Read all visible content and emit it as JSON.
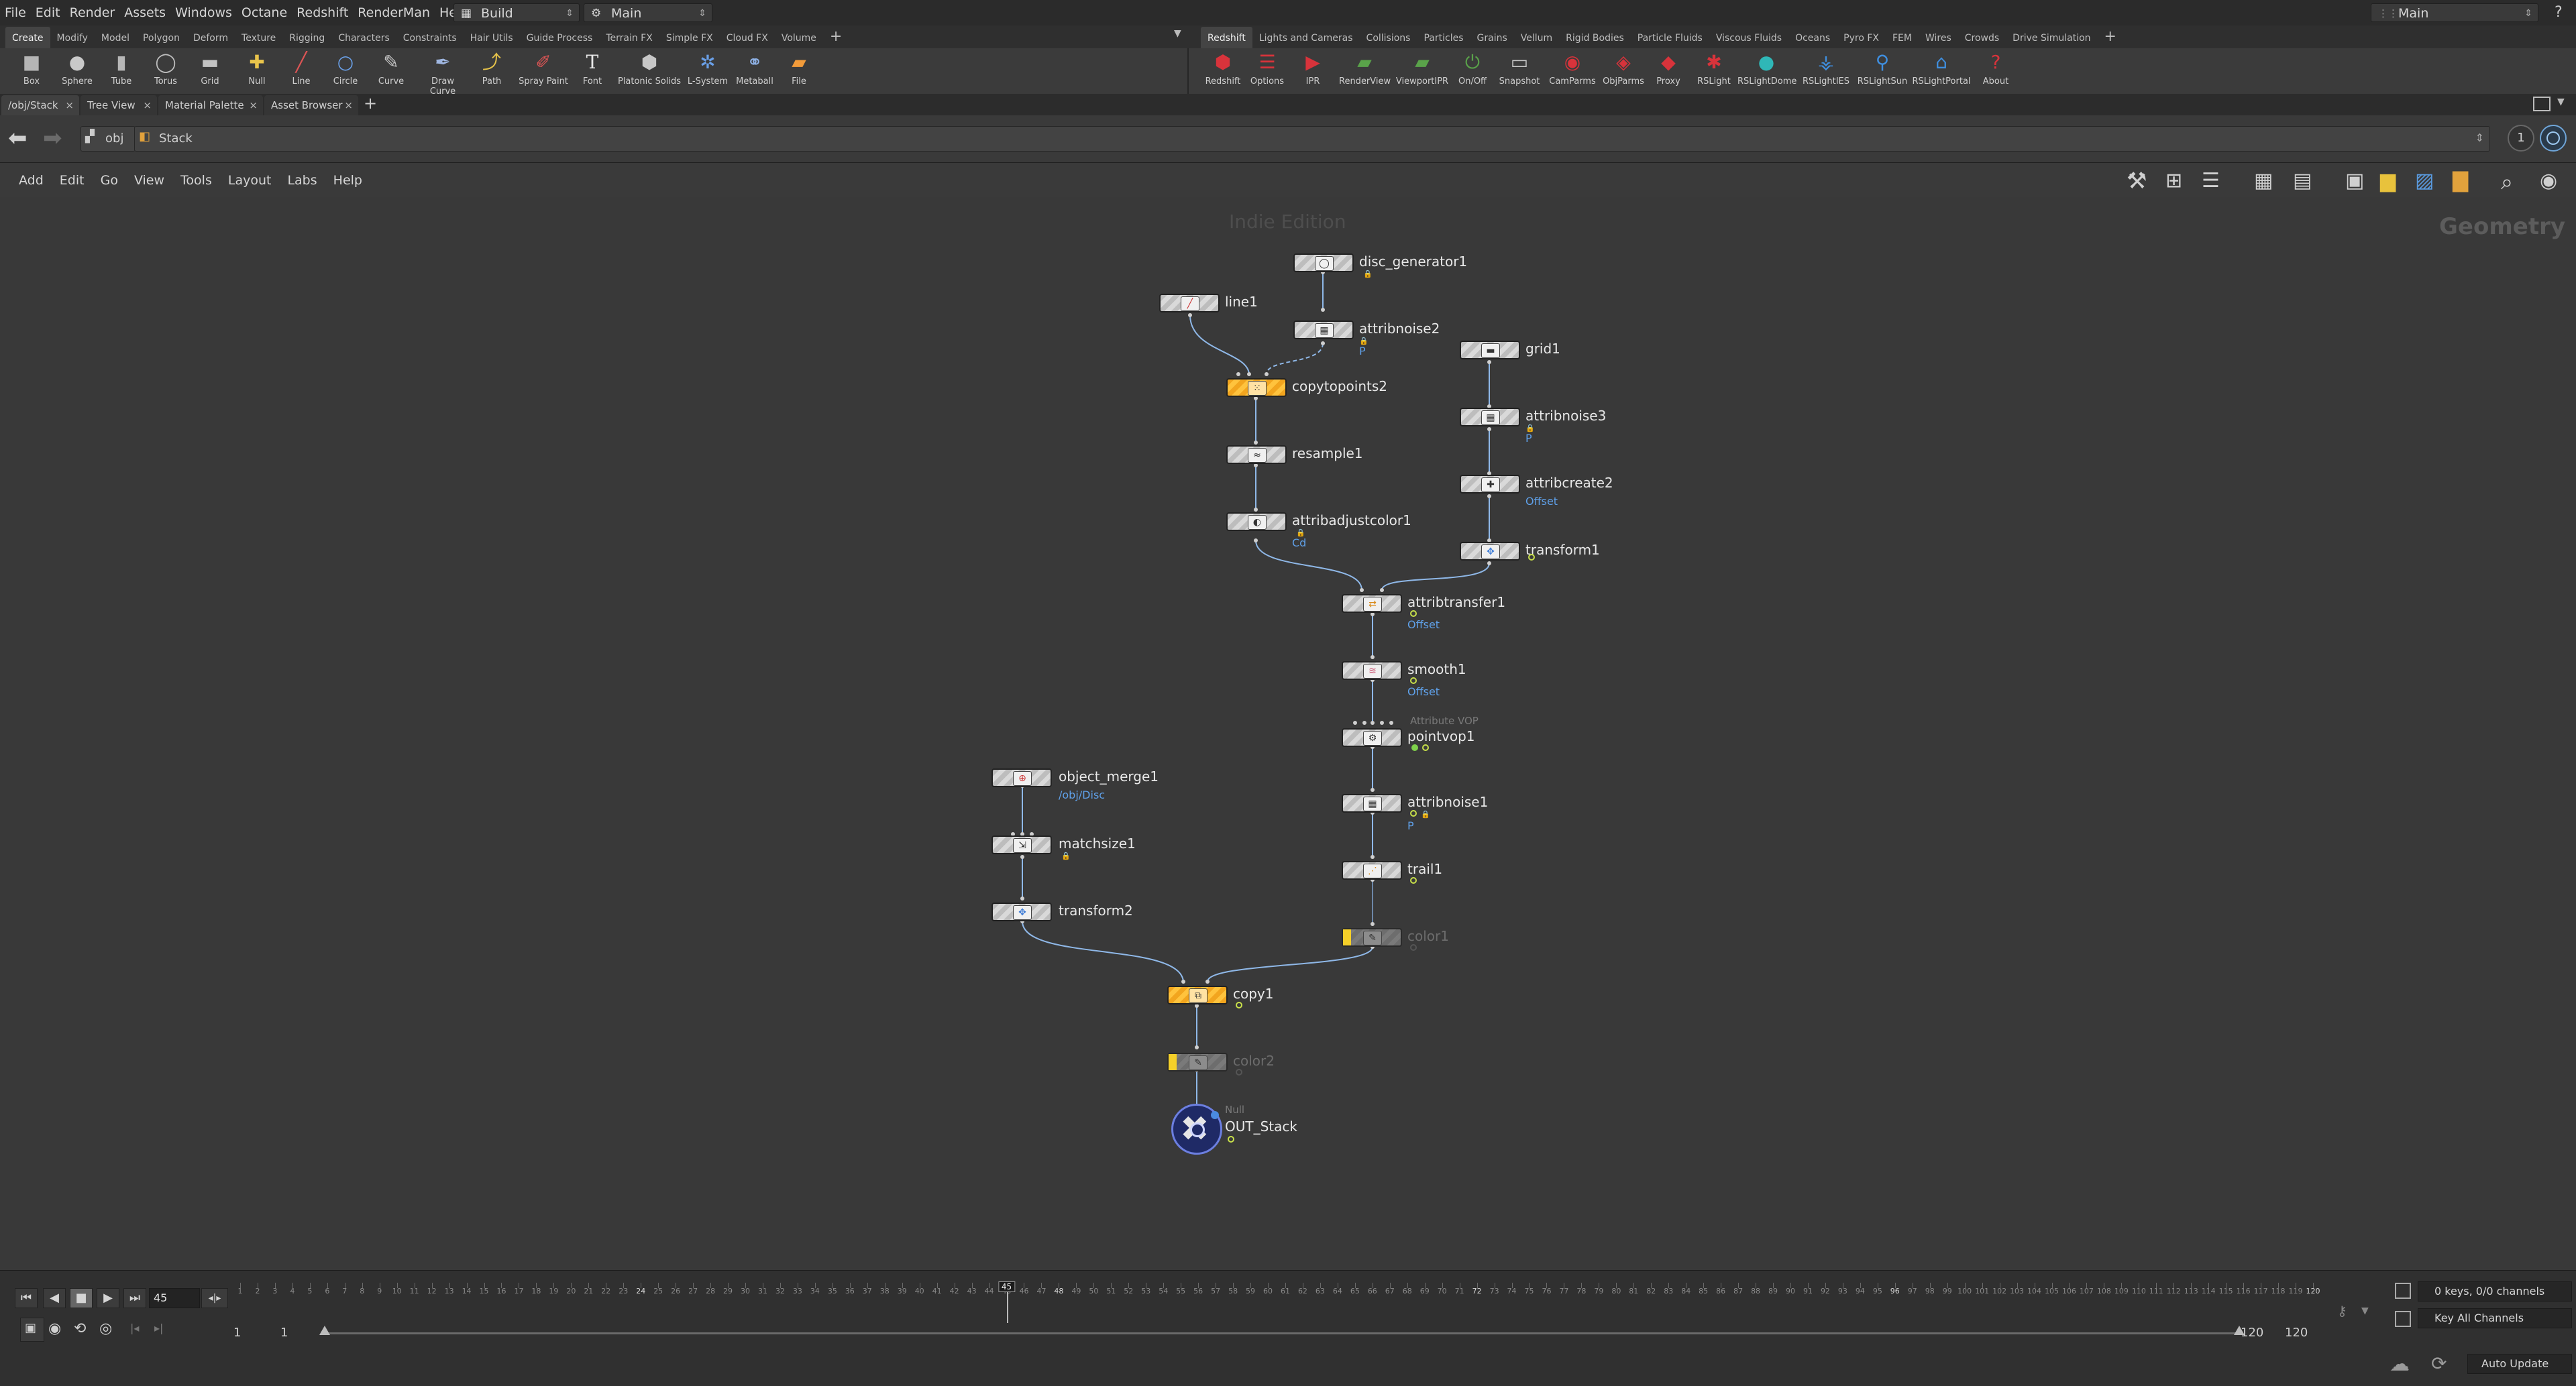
{
  "menubar": {
    "items": [
      "File",
      "Edit",
      "Render",
      "Assets",
      "Windows",
      "Octane",
      "Redshift",
      "RenderMan",
      "Help"
    ],
    "desktop": "Build",
    "main": "Main",
    "right_main": "Main",
    "help": "?"
  },
  "shelf_tabs_left": [
    "Create",
    "Modify",
    "Model",
    "Polygon",
    "Deform",
    "Texture",
    "Rigging",
    "Characters",
    "Constraints",
    "Hair Utils",
    "Guide Process",
    "Terrain FX",
    "Simple FX",
    "Cloud FX",
    "Volume"
  ],
  "shelf_tabs_right": [
    "Redshift",
    "Lights and Cameras",
    "Collisions",
    "Particles",
    "Grains",
    "Vellum",
    "Rigid Bodies",
    "Particle Fluids",
    "Viscous Fluids",
    "Oceans",
    "Pyro FX",
    "FEM",
    "Wires",
    "Crowds",
    "Drive Simulation"
  ],
  "tools_left": [
    "Box",
    "Sphere",
    "Tube",
    "Torus",
    "Grid",
    "Null",
    "Line",
    "Circle",
    "Curve",
    "Draw Curve",
    "Path",
    "Spray Paint",
    "Font",
    "Platonic Solids",
    "L-System",
    "Metaball",
    "File"
  ],
  "tools_right": [
    "Redshift",
    "Options",
    "IPR",
    "RenderView",
    "ViewportIPR",
    "On/Off",
    "Snapshot",
    "CamParms",
    "ObjParms",
    "Proxy",
    "RSLight",
    "RSLightDome",
    "RSLightIES",
    "RSLightSun",
    "RSLightPortal",
    "About"
  ],
  "pane_tabs": [
    "/obj/Stack",
    "Tree View",
    "Material Palette",
    "Asset Browser"
  ],
  "path": {
    "root": "obj",
    "current": "Stack",
    "viewport_num": "1"
  },
  "network_menu": [
    "Add",
    "Edit",
    "Go",
    "View",
    "Tools",
    "Layout",
    "Labs",
    "Help"
  ],
  "network": {
    "watermark": "Indie Edition",
    "context": "Geometry",
    "nodes": {
      "disc_generator1": {
        "name": "disc_generator1"
      },
      "line1": {
        "name": "line1"
      },
      "attribnoise2": {
        "name": "attribnoise2",
        "sub": "P"
      },
      "copytopoints2": {
        "name": "copytopoints2"
      },
      "resample1": {
        "name": "resample1"
      },
      "attribadjustcolor1": {
        "name": "attribadjustcolor1",
        "sub": "Cd"
      },
      "grid1": {
        "name": "grid1"
      },
      "attribnoise3": {
        "name": "attribnoise3",
        "sub": "P"
      },
      "attribcreate2": {
        "name": "attribcreate2",
        "sub": "Offset"
      },
      "transform1": {
        "name": "transform1"
      },
      "attribtransfer1": {
        "name": "attribtransfer1",
        "sub": "Offset"
      },
      "smooth1": {
        "name": "smooth1",
        "sub": "Offset"
      },
      "pointvop1": {
        "name": "pointvop1",
        "type": "Attribute VOP"
      },
      "attribnoise1": {
        "name": "attribnoise1",
        "sub": "P"
      },
      "trail1": {
        "name": "trail1"
      },
      "color1": {
        "name": "color1"
      },
      "object_merge1": {
        "name": "object_merge1",
        "sub": "/obj/Disc"
      },
      "matchsize1": {
        "name": "matchsize1"
      },
      "transform2": {
        "name": "transform2"
      },
      "copy1": {
        "name": "copy1"
      },
      "color2": {
        "name": "color2"
      },
      "OUT_Stack": {
        "name": "OUT_Stack",
        "type": "Null"
      }
    }
  },
  "timeline": {
    "current_frame": "45",
    "playhead_frame": "45",
    "start": "1",
    "start2": "1",
    "end": "120",
    "end2": "120",
    "ruler_first": 1,
    "ruler_last": 120,
    "major_ticks": [
      24,
      48,
      72,
      96,
      120
    ],
    "keys_label": "0 keys, 0/0 channels",
    "key_all": "Key All Channels",
    "auto_update": "Auto Update"
  }
}
